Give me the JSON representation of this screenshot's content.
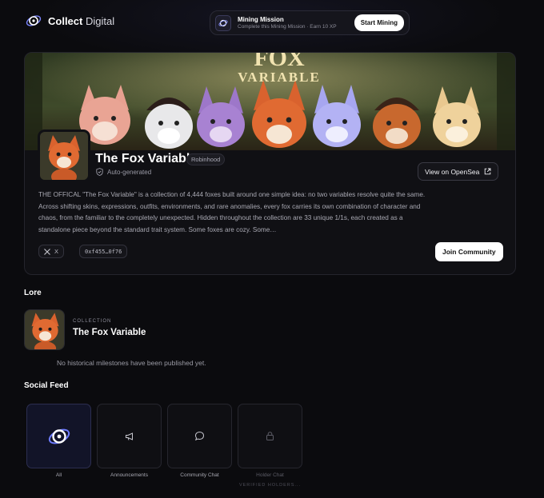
{
  "brand": {
    "name_bold": "Collect",
    "name_light": "Digital",
    "logo_icon": "orbit-logo-icon"
  },
  "mission": {
    "title": "Mining Mission",
    "subtitle": "Complete this Mining Mission · Earn 10 XP",
    "button_label": "Start Mining"
  },
  "collection": {
    "banner_line1": "FOX",
    "banner_line2": "VARIABLE",
    "name": "The Fox Variable",
    "chain_badge": "Robinhood",
    "auto_generated": "Auto-generated",
    "opensea_label": "View on OpenSea",
    "description": "THE OFFICAL \"The Fox Variable\" is a collection of 4,444 foxes built around one simple idea: no two variables resolve quite the same. Across shifting skins, expressions, outfits, environments, and rare anomalies, every fox carries its own combination of character and chaos, from the familiar to the completely unexpected. Hidden throughout the collection are 33 unique 1/1s, each created as a standalone piece beyond the standard trait system. Some foxes are cozy. Some…",
    "x_label": "X",
    "contract_address": "0xf455…0f76",
    "join_label": "Join Community"
  },
  "lore": {
    "section_title": "Lore",
    "kicker": "COLLECTION",
    "name": "The Fox Variable",
    "empty_message": "No historical milestones have been published yet."
  },
  "social_feed": {
    "section_title": "Social Feed",
    "tiles": [
      {
        "label": "All",
        "icon": "orbit-logo-icon",
        "active": true
      },
      {
        "label": "Announcements",
        "icon": "megaphone-icon"
      },
      {
        "label": "Community Chat",
        "icon": "chat-bubble-icon"
      },
      {
        "label": "Holder Chat",
        "icon": "lock-icon",
        "sublabel": "VERIFIED HOLDERS..."
      }
    ]
  },
  "colors": {
    "background": "#0b0b0e",
    "card": "#101014",
    "accent": "#5b6cff"
  }
}
